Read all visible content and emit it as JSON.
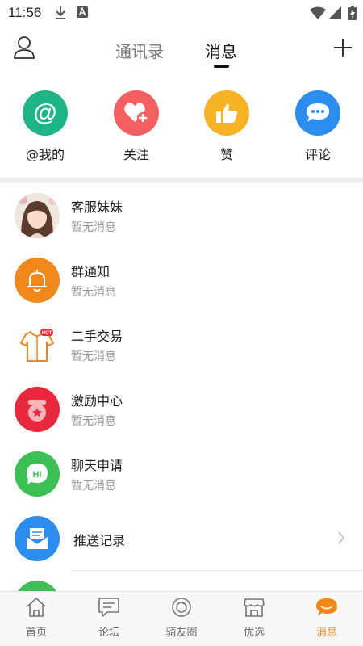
{
  "status_bar": {
    "time": "11:56"
  },
  "header": {
    "tabs": [
      {
        "label": "通讯录",
        "active": false
      },
      {
        "label": "消息",
        "active": true
      }
    ]
  },
  "quick_actions": [
    {
      "label": "@我的",
      "icon": "at-icon",
      "color": "#1fb487"
    },
    {
      "label": "关注",
      "icon": "heart-plus-icon",
      "color": "#f55f61"
    },
    {
      "label": "赞",
      "icon": "thumbs-up-icon",
      "color": "#f7b325"
    },
    {
      "label": "评论",
      "icon": "comment-icon",
      "color": "#2a8def"
    }
  ],
  "messages": [
    {
      "title": "客服妹妹",
      "subtitle": "暂无消息",
      "icon": "customer-service-avatar"
    },
    {
      "title": "群通知",
      "subtitle": "暂无消息",
      "icon": "bell-icon",
      "color": "#f0881b"
    },
    {
      "title": "二手交易",
      "subtitle": "暂无消息",
      "icon": "shirt-hot-icon",
      "color": "#f0881b"
    },
    {
      "title": "激励中心",
      "subtitle": "暂无消息",
      "icon": "incentive-icon",
      "color": "#e8283b"
    },
    {
      "title": "聊天申请",
      "subtitle": "暂无消息",
      "icon": "hi-chat-icon",
      "color": "#3cbf53"
    },
    {
      "title": "推送记录",
      "icon": "push-envelope-icon",
      "color": "#2a8def"
    }
  ],
  "bottom_nav": [
    {
      "label": "首页",
      "icon": "home-icon",
      "active": false
    },
    {
      "label": "论坛",
      "icon": "forum-icon",
      "active": false
    },
    {
      "label": "骑友圈",
      "icon": "moments-icon",
      "active": false
    },
    {
      "label": "优选",
      "icon": "shop-icon",
      "active": false
    },
    {
      "label": "消息",
      "icon": "message-icon",
      "active": true
    }
  ],
  "colors": {
    "accent": "#f0881b"
  }
}
